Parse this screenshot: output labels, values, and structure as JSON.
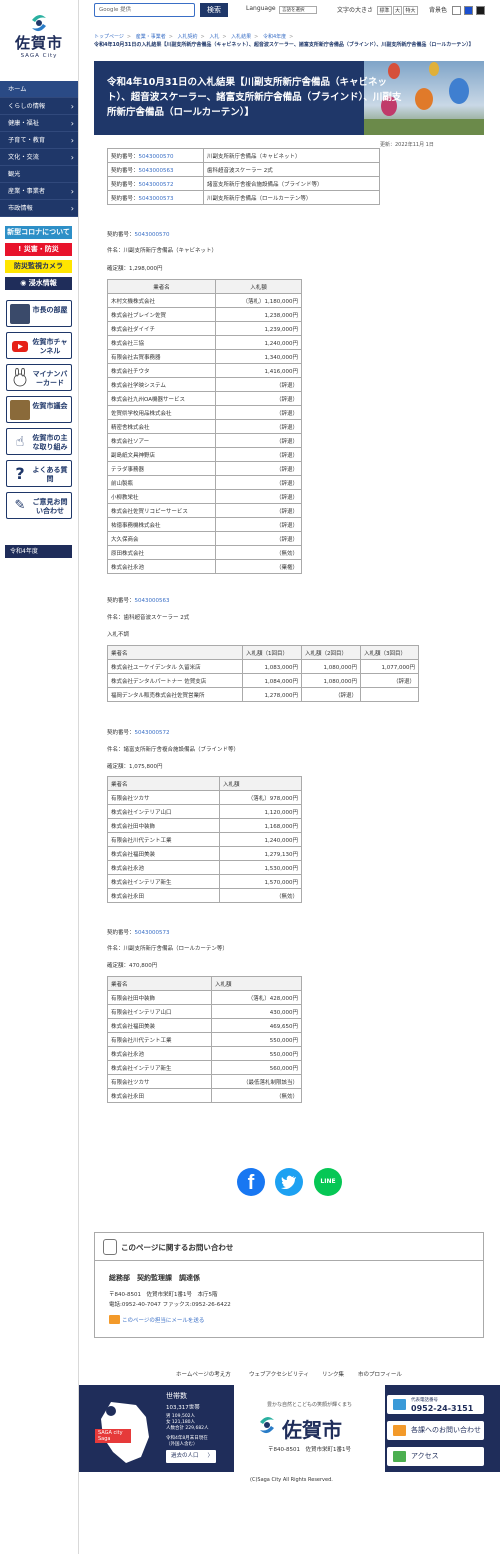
{
  "logo": {
    "jp": "佐賀市",
    "en": "SAGA City"
  },
  "nav": {
    "home": "ホーム",
    "items": [
      "くらしの情報",
      "健康・福祉",
      "子育て・教育",
      "文化・交流",
      "観光",
      "産業・事業者",
      "市政情報"
    ]
  },
  "banners": {
    "corona": "新型コロナについて",
    "saigai": "災害・防災",
    "camera": "防災監視カメラ",
    "shinsui": "浸水情報"
  },
  "tiles": [
    {
      "label": "市長の部屋"
    },
    {
      "label": "佐賀市チャンネル"
    },
    {
      "label": "マイナンバーカード"
    },
    {
      "label": "佐賀市議会"
    },
    {
      "label": "佐賀市の主な取り組み"
    },
    {
      "label": "よくある質問"
    },
    {
      "label": "ご意見お問い合わせ"
    }
  ],
  "year_label": "令和4年度",
  "topbar": {
    "search_placeholder": "Google 提供",
    "search_button": "検索",
    "language_label": "Language",
    "language_select": "言語を選択",
    "fontsize_label": "文字の大きさ",
    "fontsize_options": [
      "標準",
      "大",
      "特大"
    ],
    "bgcolor_label": "背景色",
    "bg_colors": [
      "#ffffff",
      "#1a4fd0",
      "#1a1a1a"
    ]
  },
  "breadcrumb": [
    "トップページ",
    "産業・事業者",
    "入札契約",
    "入札",
    "入札結果",
    "令和4年度"
  ],
  "breadcrumb_current": "令和4年10月31日の入札結果【川副支所新庁舎備品（キャビネット）、超音波スケーラー、諸富支所新庁舎備品（ブラインド）、川副支所新庁舎備品（ロールカーテン）】",
  "title": "令和4年10月31日の入札結果【川副支所新庁舎備品（キャビネット）、超音波スケーラー、諸富支所新庁舎備品（ブラインド）、川副支所新庁舎備品（ロールカーテン）】",
  "updated": "更新：2022年11月 1日",
  "summary": [
    {
      "label": "契約番号：",
      "no": "5043000570",
      "name": "川副支所新庁舎備品（キャビネット）"
    },
    {
      "label": "契約番号：",
      "no": "5043000563",
      "name": "歯科超音波スケーラー 2式"
    },
    {
      "label": "契約番号：",
      "no": "5043000572",
      "name": "諸富支所新庁舎複合施設備品（ブラインド等）"
    },
    {
      "label": "契約番号：",
      "no": "5043000573",
      "name": "川副支所新庁舎備品（ロールカーテン等）"
    }
  ],
  "c1": {
    "no_label": "契約番号：",
    "no": "5043000570",
    "item": "件名：川副支所新庁舎備品（キャビネット）",
    "price": "確定額：1,298,000円",
    "headers": [
      "業者名",
      "入札額"
    ],
    "rows": [
      [
        "木村文機株式会社",
        "（落札）1,180,000円"
      ],
      [
        "株式会社ブレイン佐賀",
        "1,238,000円"
      ],
      [
        "株式会社ダイイチ",
        "1,239,000円"
      ],
      [
        "株式会社三協",
        "1,240,000円"
      ],
      [
        "有限会社古賀事務器",
        "1,340,000円"
      ],
      [
        "株式会社チウタ",
        "1,416,000円"
      ],
      [
        "株式会社学映システム",
        "（辞退）"
      ],
      [
        "株式会社九州OA機器サービス",
        "（辞退）"
      ],
      [
        "佐賀県学校用品株式会社",
        "（辞退）"
      ],
      [
        "精密舎株式会社",
        "（辞退）"
      ],
      [
        "株式会社ソアー",
        "（辞退）"
      ],
      [
        "副島紙文具神野店",
        "（辞退）"
      ],
      [
        "テラダ事務器",
        "（辞退）"
      ],
      [
        "前山製瓶",
        "（辞退）"
      ],
      [
        "小柳教栄社",
        "（辞退）"
      ],
      [
        "株式会社佐賀リコピーサービス",
        "（辞退）"
      ],
      [
        "祐徳事務機株式会社",
        "（辞退）"
      ],
      [
        "大久保商会",
        "（辞退）"
      ],
      [
        "原田株式会社",
        "（無効）"
      ],
      [
        "株式会社永池",
        "（棄権）"
      ]
    ]
  },
  "c2": {
    "no_label": "契約番号：",
    "no": "5043000563",
    "item": "件名：歯科超音波スケーラー 2式",
    "price": "入札不調",
    "headers": [
      "業者名",
      "入札額（1回目）",
      "入札額（2回目）",
      "入札額（3回目）"
    ],
    "rows": [
      [
        "株式会社ユーケイデンタル 久留米店",
        "1,083,000円",
        "1,080,000円",
        "1,077,000円"
      ],
      [
        "株式会社デンタルパートナー 佐賀支店",
        "1,084,000円",
        "1,080,000円",
        "（辞退）"
      ],
      [
        "福岡デンタル販売株式会社佐賀営業所",
        "1,278,000円",
        "（辞退）",
        ""
      ]
    ]
  },
  "c3": {
    "no_label": "契約番号：",
    "no": "5043000572",
    "item": "件名：諸富支所新庁舎複合施設備品（ブラインド等）",
    "price": "確定額：1,075,800円",
    "headers": [
      "業者名",
      "入札額"
    ],
    "rows": [
      [
        "有限会社ツカサ",
        "（落札）978,000円"
      ],
      [
        "株式会社インテリア山口",
        "1,120,000円"
      ],
      [
        "株式会社田中装飾",
        "1,168,000円"
      ],
      [
        "有限会社川代テント工業",
        "1,240,000円"
      ],
      [
        "株式会社福田美装",
        "1,279,130円"
      ],
      [
        "株式会社永池",
        "1,530,000円"
      ],
      [
        "株式会社インテリア新生",
        "1,570,000円"
      ],
      [
        "株式会社永田",
        "（無効）"
      ]
    ]
  },
  "c4": {
    "no_label": "契約番号：",
    "no": "5043000573",
    "item": "件名：川副支所新庁舎備品（ロールカーテン等）",
    "price": "確定額：470,800円",
    "headers": [
      "業者名",
      "入札額"
    ],
    "rows": [
      [
        "有限会社田中装飾",
        "（落札）428,000円"
      ],
      [
        "有限会社インテリア山口",
        "430,000円"
      ],
      [
        "株式会社福田美装",
        "469,650円"
      ],
      [
        "有限会社川代テント工業",
        "550,000円"
      ],
      [
        "株式会社永池",
        "550,000円"
      ],
      [
        "株式会社インテリア新生",
        "560,000円"
      ],
      [
        "有限会社ツカサ",
        "（最低落札制限該当）"
      ],
      [
        "株式会社永田",
        "（無効）"
      ]
    ]
  },
  "contact": {
    "heading": "このページに関するお問い合わせ",
    "dept": "総務部　契約監理課　調達係",
    "addr": "〒840-8501　佐賀市栄町1番1号　本庁5階",
    "tel": "電話:0952-40-7047 ファックス:0952-26-6422",
    "mail": "このページの担当にメールを送る"
  },
  "footer_links": [
    "ホームページの考え方",
    "ウェブアクセシビリティ",
    "リンク集",
    "市のプロフィール"
  ],
  "footer": {
    "households_label": "世帯数",
    "households": "103,317世帯",
    "pop1": "男 109,502人",
    "pop2": "女 121,180人",
    "pop3": "人数合計 229,682人",
    "date": "令和4年8月末日現在",
    "date2": "（外国人含む）",
    "past": "過去の人口",
    "map_label": "SAGA city Saga",
    "tagline": "豊かな自然とこどもの笑顔が輝くまち",
    "city": "佐賀市",
    "addr": "〒840-8501　佐賀市栄町1番1号",
    "tel_label": "代表電話番号",
    "tel": "0952-24-3151",
    "contact_btn": "各課へのお問い合わせ",
    "access_btn": "アクセス",
    "copyright": "(C)Saga City All Rights Reserved."
  },
  "colors": {
    "navy": "#1f3769",
    "link": "#3a6fc6",
    "facebook": "#1877f2",
    "twitter": "#1da1f2",
    "line": "#06c755"
  }
}
